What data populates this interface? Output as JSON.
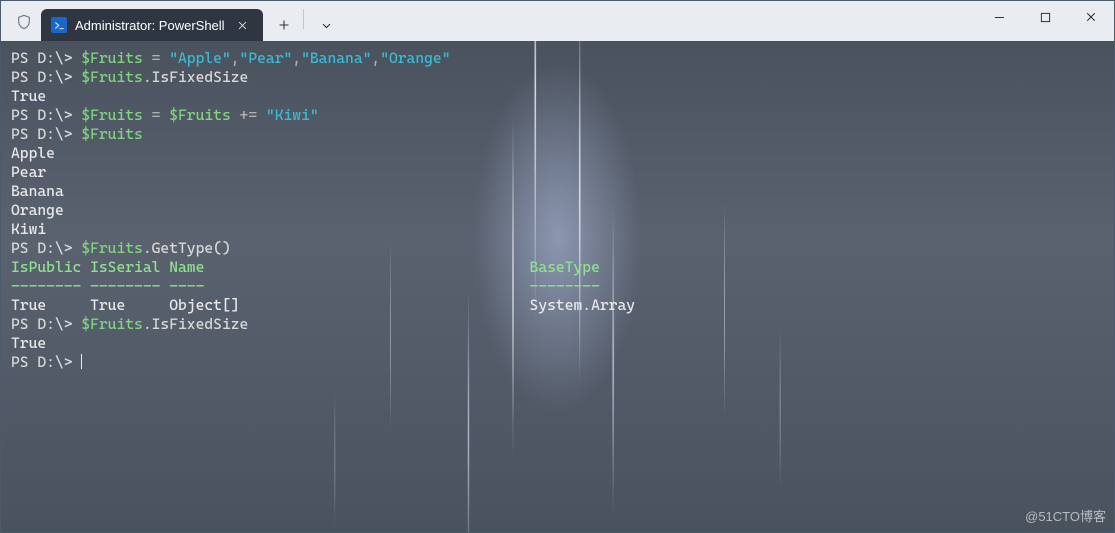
{
  "window": {
    "tab_title": "Administrator: PowerShell",
    "watermark": "@51CTO博客"
  },
  "colors": {
    "variable": "#7fd47f",
    "string": "#38bcd6",
    "header": "#8fe28f",
    "text": "#e8e8e8",
    "tab_bg": "#2f3541",
    "titlebar_bg": "#e9ecf1"
  },
  "session": {
    "prompt_text": "PS D:\\>",
    "lines": [
      {
        "type": "cmd",
        "segments": [
          {
            "cls": "c-prompt",
            "t": "PS D:\\> "
          },
          {
            "cls": "c-var",
            "t": "$Fruits"
          },
          {
            "cls": "c-op",
            "t": " = "
          },
          {
            "cls": "c-str",
            "t": "\"Apple\""
          },
          {
            "cls": "c-op",
            "t": ","
          },
          {
            "cls": "c-str",
            "t": "\"Pear\""
          },
          {
            "cls": "c-op",
            "t": ","
          },
          {
            "cls": "c-str",
            "t": "\"Banana\""
          },
          {
            "cls": "c-op",
            "t": ","
          },
          {
            "cls": "c-str",
            "t": "\"Orange\""
          }
        ]
      },
      {
        "type": "cmd",
        "segments": [
          {
            "cls": "c-prompt",
            "t": "PS D:\\> "
          },
          {
            "cls": "c-var",
            "t": "$Fruits"
          },
          {
            "cls": "c-meth",
            "t": ".IsFixedSize"
          }
        ]
      },
      {
        "type": "out",
        "segments": [
          {
            "cls": "",
            "t": "True"
          }
        ]
      },
      {
        "type": "cmd",
        "segments": [
          {
            "cls": "c-prompt",
            "t": "PS D:\\> "
          },
          {
            "cls": "c-var",
            "t": "$Fruits"
          },
          {
            "cls": "c-op",
            "t": " = "
          },
          {
            "cls": "c-var",
            "t": "$Fruits"
          },
          {
            "cls": "c-op",
            "t": " += "
          },
          {
            "cls": "c-str",
            "t": "\"Kiwi\""
          }
        ]
      },
      {
        "type": "cmd",
        "segments": [
          {
            "cls": "c-prompt",
            "t": "PS D:\\> "
          },
          {
            "cls": "c-var",
            "t": "$Fruits"
          }
        ]
      },
      {
        "type": "out",
        "segments": [
          {
            "cls": "",
            "t": "Apple"
          }
        ]
      },
      {
        "type": "out",
        "segments": [
          {
            "cls": "",
            "t": "Pear"
          }
        ]
      },
      {
        "type": "out",
        "segments": [
          {
            "cls": "",
            "t": "Banana"
          }
        ]
      },
      {
        "type": "out",
        "segments": [
          {
            "cls": "",
            "t": "Orange"
          }
        ]
      },
      {
        "type": "out",
        "segments": [
          {
            "cls": "",
            "t": "Kiwi"
          }
        ]
      },
      {
        "type": "cmd",
        "segments": [
          {
            "cls": "c-prompt",
            "t": "PS D:\\> "
          },
          {
            "cls": "c-var",
            "t": "$Fruits"
          },
          {
            "cls": "c-meth",
            "t": ".GetType()"
          }
        ]
      },
      {
        "type": "blank",
        "segments": [
          {
            "cls": "",
            "t": ""
          }
        ]
      },
      {
        "type": "hdr",
        "segments": [
          {
            "cls": "c-hdr",
            "t": "IsPublic IsSerial Name                                     BaseType"
          }
        ]
      },
      {
        "type": "hdr",
        "segments": [
          {
            "cls": "c-hdr",
            "t": "-------- -------- ----                                     --------"
          }
        ]
      },
      {
        "type": "out",
        "segments": [
          {
            "cls": "",
            "t": "True     True     Object[]                                 System.Array"
          }
        ]
      },
      {
        "type": "blank",
        "segments": [
          {
            "cls": "",
            "t": ""
          }
        ]
      },
      {
        "type": "cmd",
        "segments": [
          {
            "cls": "c-prompt",
            "t": "PS D:\\> "
          },
          {
            "cls": "c-var",
            "t": "$Fruits"
          },
          {
            "cls": "c-meth",
            "t": ".IsFixedSize"
          }
        ]
      },
      {
        "type": "out",
        "segments": [
          {
            "cls": "",
            "t": "True"
          }
        ]
      },
      {
        "type": "cmd",
        "cursor": true,
        "segments": [
          {
            "cls": "c-prompt",
            "t": "PS D:\\> "
          }
        ]
      }
    ],
    "gettype_result": {
      "columns": [
        "IsPublic",
        "IsSerial",
        "Name",
        "BaseType"
      ],
      "rows": [
        {
          "IsPublic": "True",
          "IsSerial": "True",
          "Name": "Object[]",
          "BaseType": "System.Array"
        }
      ]
    },
    "fruits_after_append": [
      "Apple",
      "Pear",
      "Banana",
      "Orange",
      "Kiwi"
    ]
  }
}
